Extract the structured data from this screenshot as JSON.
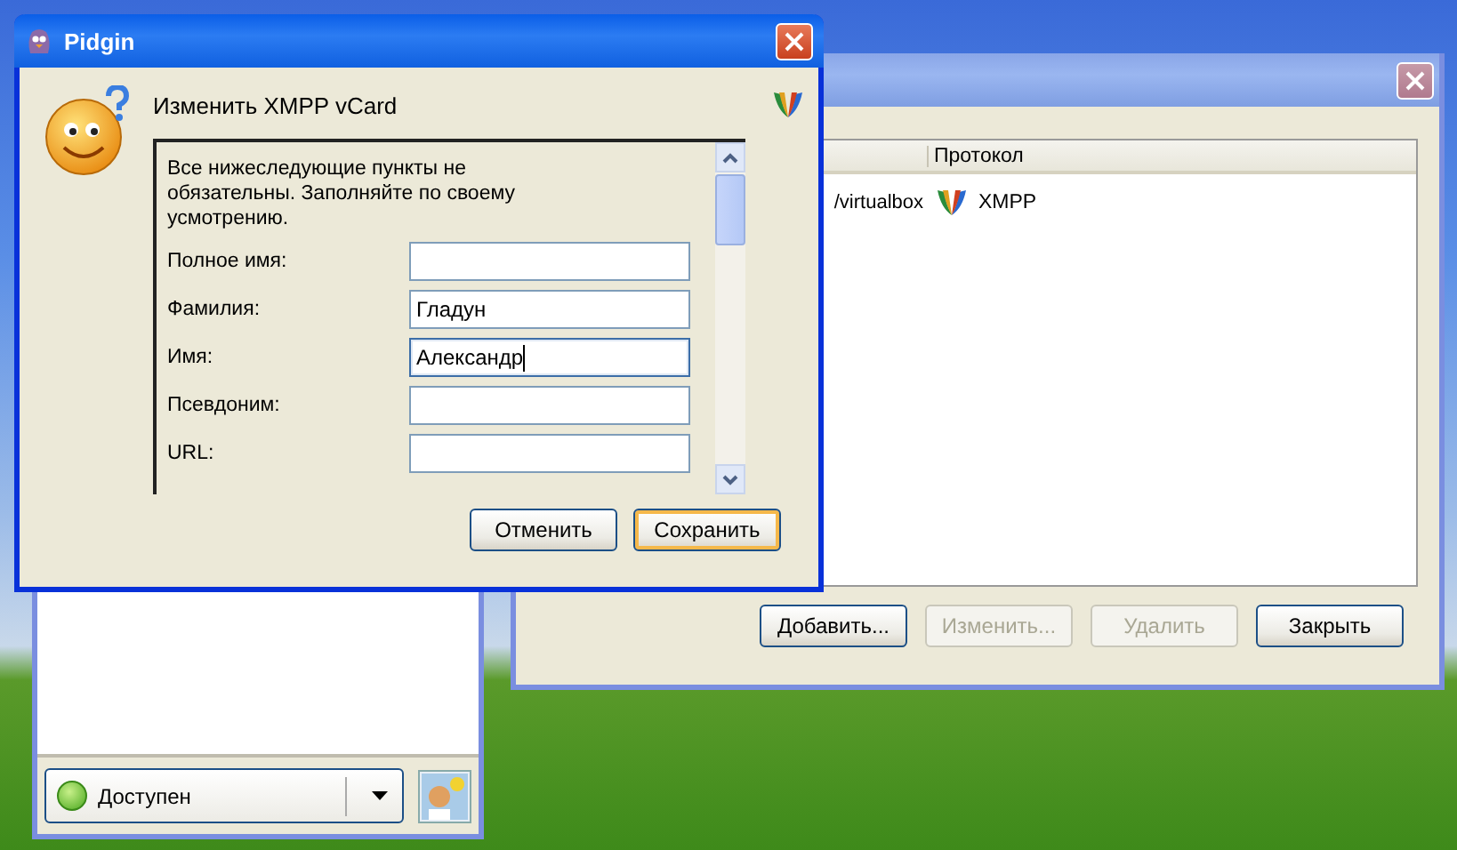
{
  "buddy_list": {
    "status": {
      "label": "Доступен"
    }
  },
  "accounts_window": {
    "columns": [
      "Протокол"
    ],
    "rows": [
      {
        "column_1": "/virtualbox",
        "protocol": "XMPP"
      }
    ],
    "buttons": [
      {
        "label": "Добавить...",
        "disabled": false
      },
      {
        "label": "Изменить...",
        "disabled": true
      },
      {
        "label": "Удалить",
        "disabled": true
      },
      {
        "label": "Закрыть",
        "disabled": false
      }
    ]
  },
  "dialog": {
    "title": "Pidgin",
    "heading": "Изменить XMPP vCard",
    "intro": "Все нижеследующие пункты не обязательны. Заполняйте по своему усмотрению.",
    "fields": [
      {
        "label": "Полное имя:",
        "focused": false
      },
      {
        "label": "Фамилия:",
        "value": "Гладун",
        "focused": false
      },
      {
        "label": "Имя:",
        "value": "Александр",
        "focused": true
      },
      {
        "label": "Псевдоним:",
        "focused": false
      },
      {
        "label": "URL:",
        "focused": false
      }
    ],
    "buttons": [
      {
        "label": "Отменить",
        "default": false
      },
      {
        "label": "Сохранить",
        "default": true
      }
    ]
  }
}
